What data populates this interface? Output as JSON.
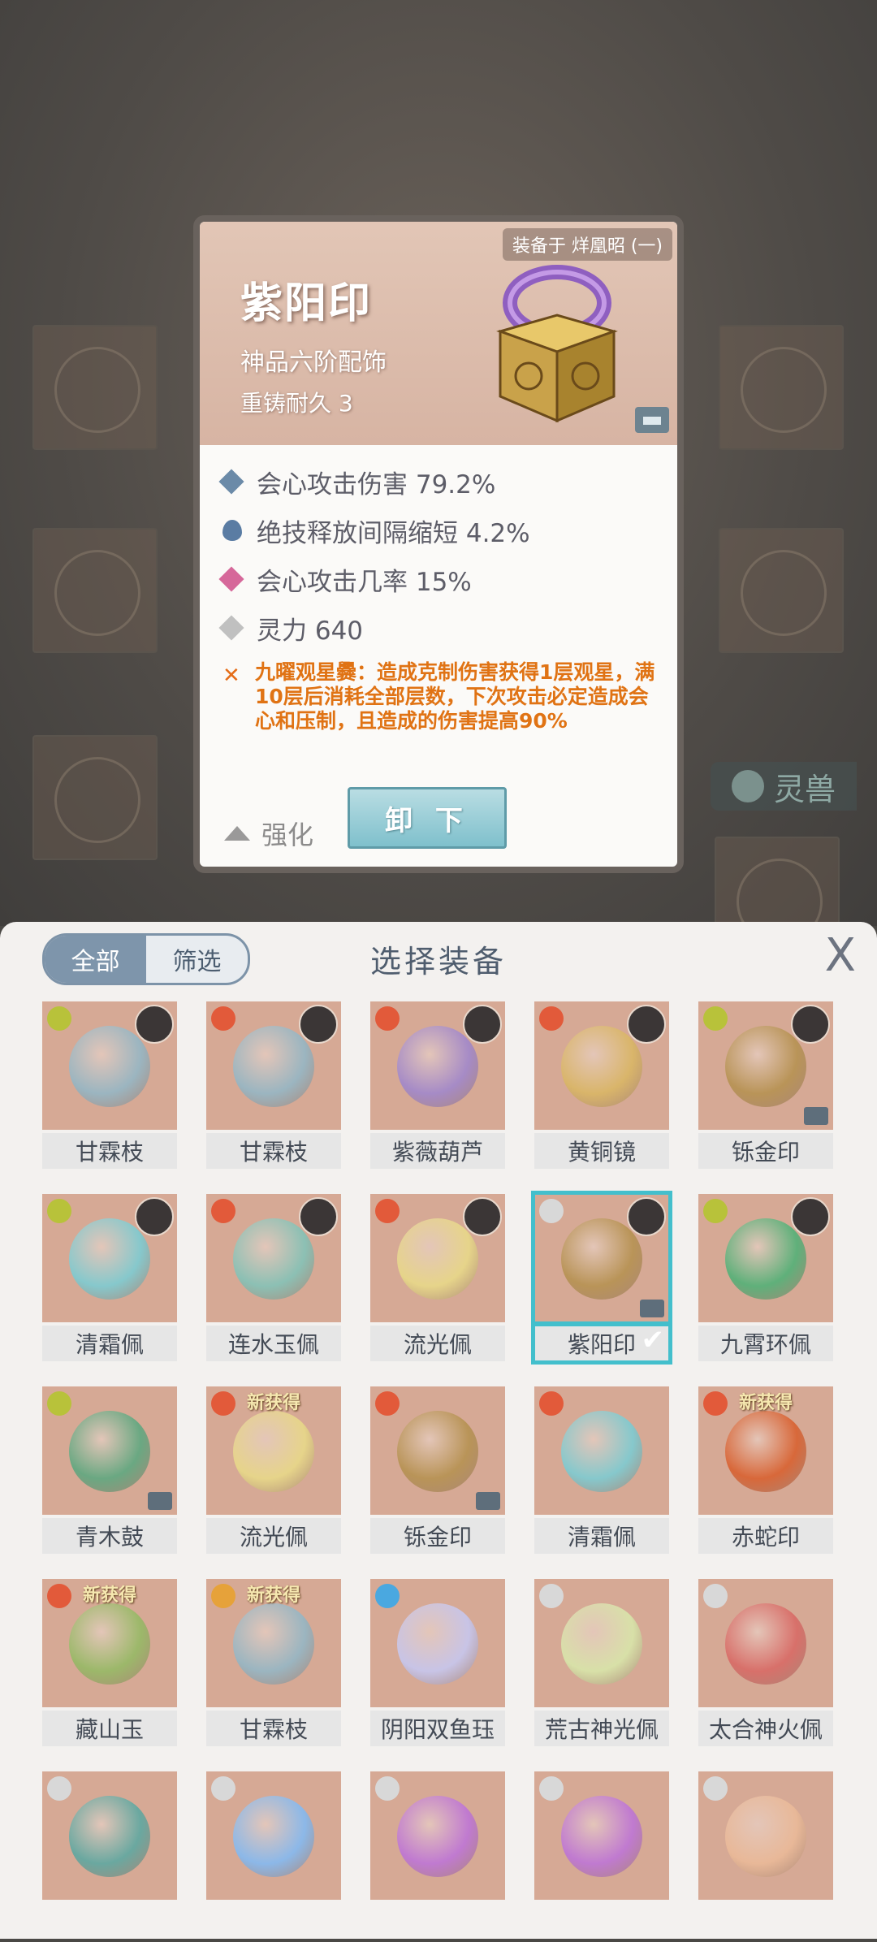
{
  "detail": {
    "equipped_label": "装备于 烊凰昭 (一)",
    "name": "紫阳印",
    "grade": "神品六阶配饰",
    "durability": "重铸耐久 3",
    "stats": [
      {
        "text": "会心攻击伤害 79.2%",
        "color": "#6b8aa8"
      },
      {
        "text": "绝技释放间隔缩短 4.2%",
        "color": "#5a7ca3"
      },
      {
        "text": "会心攻击几率 15%",
        "color": "#d6689a"
      },
      {
        "text": "灵力 640",
        "color": "#c0c0c0"
      }
    ],
    "skill": "九曜观星爨：造成克制伤害获得1层观星，满10层后消耗全部层数，下次攻击必定造成会心和压制，且造成的伤害提高90%",
    "enhance_label": "强化",
    "unequip_label": "卸 下"
  },
  "background": {
    "spirit_beast_label": "灵兽"
  },
  "panel": {
    "filter_all": "全部",
    "filter_screen": "筛选",
    "title": "选择装备",
    "close": "X"
  },
  "items": [
    {
      "name": "甘霖枝",
      "elem": "#b8c23a",
      "avatar": true,
      "shape": "#9bb5c0"
    },
    {
      "name": "甘霖枝",
      "elem": "#e25a3a",
      "avatar": true,
      "shape": "#9bb5c0"
    },
    {
      "name": "紫薇葫芦",
      "elem": "#e25a3a",
      "avatar": true,
      "shape": "#a68bc6"
    },
    {
      "name": "黄铜镜",
      "elem": "#e25a3a",
      "avatar": true,
      "shape": "#d9b56a"
    },
    {
      "name": "铄金印",
      "elem": "#b8c23a",
      "avatar": true,
      "shape": "#b99458",
      "mini": true
    },
    {
      "name": "清霜佩",
      "elem": "#b8c23a",
      "avatar": true,
      "shape": "#86c8cc"
    },
    {
      "name": "连水玉佩",
      "elem": "#e25a3a",
      "avatar": true,
      "shape": "#8cc0b4"
    },
    {
      "name": "流光佩",
      "elem": "#e25a3a",
      "avatar": true,
      "shape": "#e6d48a"
    },
    {
      "name": "紫阳印",
      "elem": "#d8d8d8",
      "avatar": true,
      "shape": "#b99458",
      "mini": true,
      "selected": true
    },
    {
      "name": "九霄环佩",
      "elem": "#b8c23a",
      "avatar": true,
      "shape": "#5fb07a"
    },
    {
      "name": "青木鼓",
      "elem": "#b8c23a",
      "avatar": false,
      "shape": "#6aa882",
      "mini": true
    },
    {
      "name": "流光佩",
      "elem": "#e25a3a",
      "avatar": false,
      "shape": "#e6d48a",
      "new": "新获得"
    },
    {
      "name": "铄金印",
      "elem": "#e25a3a",
      "avatar": false,
      "shape": "#b99458",
      "mini": true
    },
    {
      "name": "清霜佩",
      "elem": "#e25a3a",
      "avatar": false,
      "shape": "#86c8cc"
    },
    {
      "name": "赤蛇印",
      "elem": "#e25a3a",
      "avatar": false,
      "shape": "#d8683a",
      "new": "新获得"
    },
    {
      "name": "藏山玉",
      "elem": "#e25a3a",
      "avatar": false,
      "shape": "#9cb86a",
      "new": "新获得"
    },
    {
      "name": "甘霖枝",
      "elem": "#e6a23a",
      "avatar": false,
      "shape": "#9bb5c0",
      "new": "新获得"
    },
    {
      "name": "阴阳双鱼珏",
      "elem": "#4aa8e0",
      "avatar": false,
      "shape": "#c8c4e6"
    },
    {
      "name": "荒古神光佩",
      "elem": "#d8d8d8",
      "avatar": false,
      "shape": "#d8e0a8"
    },
    {
      "name": "太合神火佩",
      "elem": "#d8d8d8",
      "avatar": false,
      "shape": "#d8706a"
    },
    {
      "name": "",
      "elem": "#d8d8d8",
      "avatar": false,
      "shape": "#6aa8a0"
    },
    {
      "name": "",
      "elem": "#d8d8d8",
      "avatar": false,
      "shape": "#8cb8e8"
    },
    {
      "name": "",
      "elem": "#d8d8d8",
      "avatar": false,
      "shape": "#c07ad0"
    },
    {
      "name": "",
      "elem": "#d8d8d8",
      "avatar": false,
      "shape": "#c07ad0"
    },
    {
      "name": "",
      "elem": "#d8d8d8",
      "avatar": false,
      "shape": "#e8b898"
    }
  ]
}
